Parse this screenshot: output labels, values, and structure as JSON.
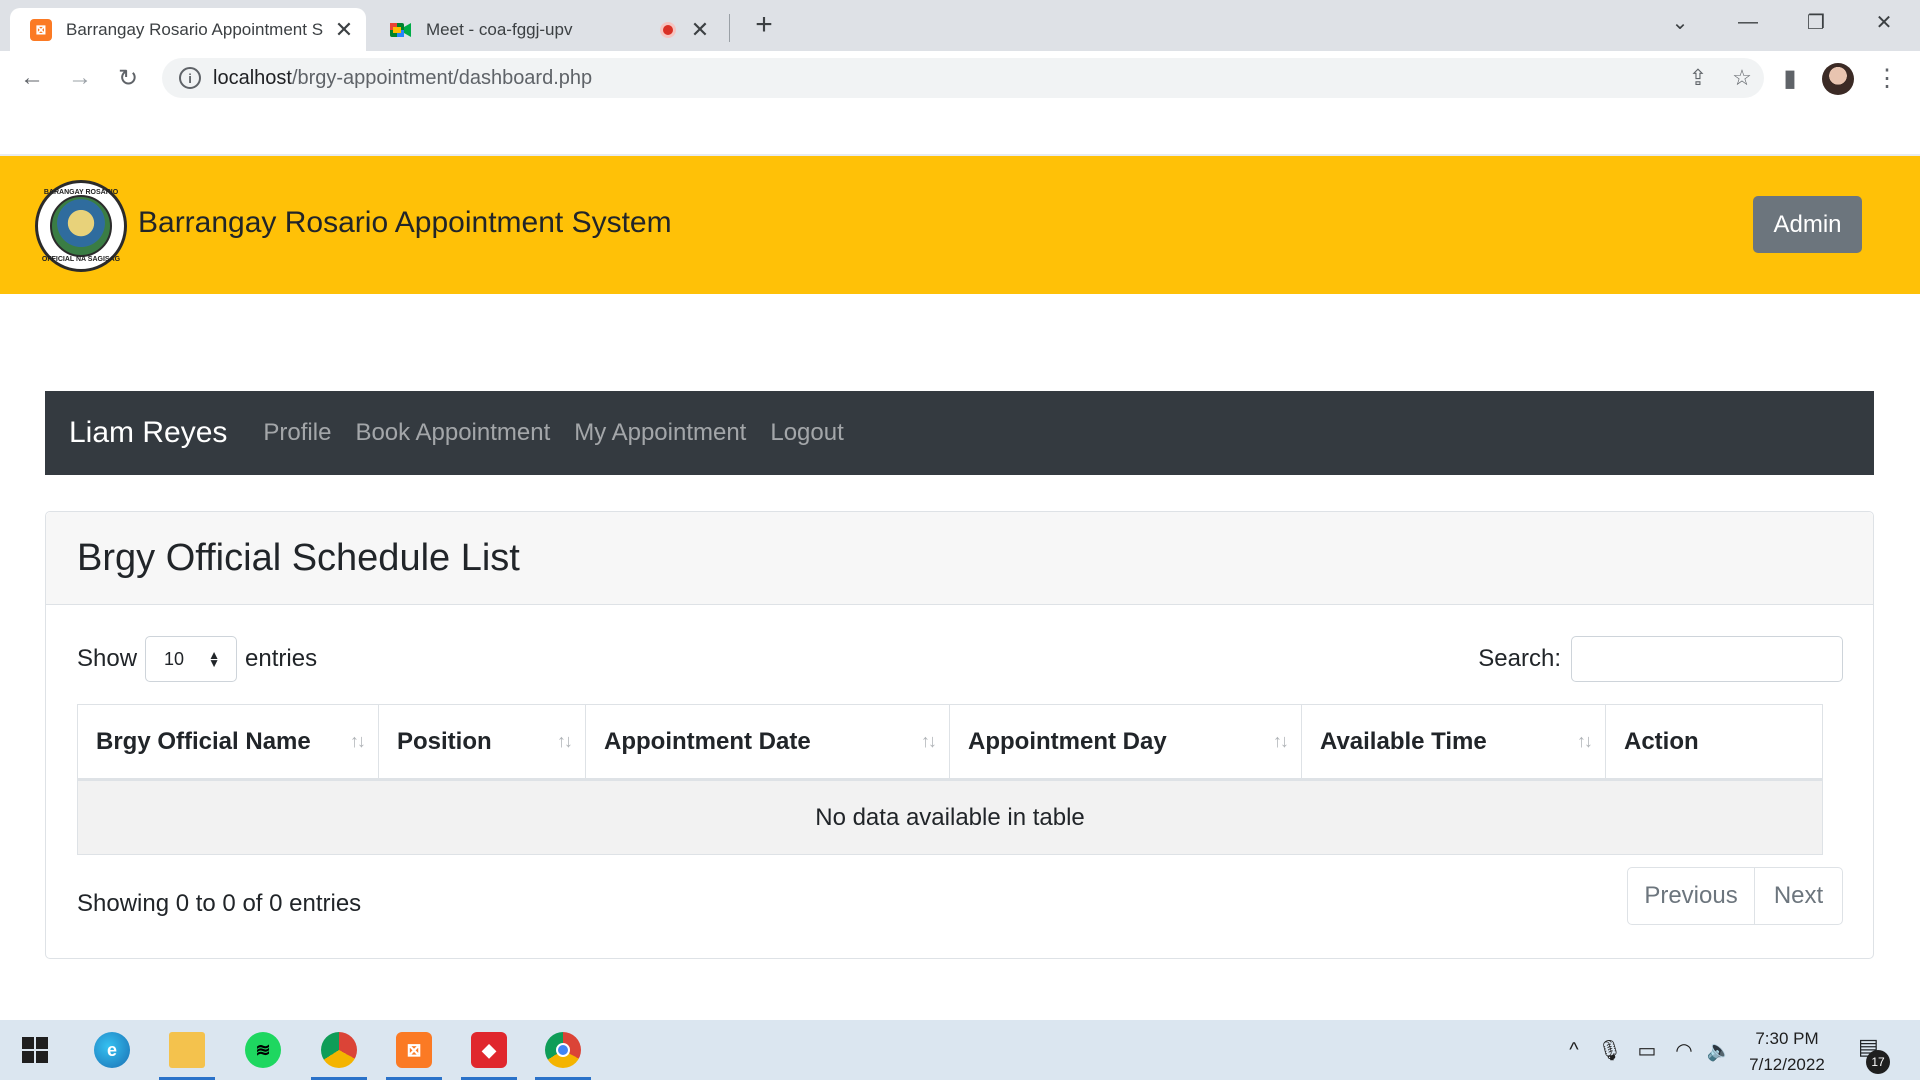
{
  "browser": {
    "tabs": [
      {
        "title": "Barrangay Rosario Appointment S",
        "active": true,
        "icon": "xampp-icon"
      },
      {
        "title": "Meet - coa-fggj-upv",
        "active": false,
        "icon": "google-meet-icon"
      }
    ],
    "url_host": "localhost",
    "url_path": "/brgy-appointment/dashboard.php"
  },
  "header": {
    "title": "Barrangay Rosario Appointment System",
    "admin_label": "Admin",
    "seal_text_top": "BARANGAY ROSARIO",
    "seal_text_bottom": "OFFICIAL NA SAGISAG",
    "accent": "#ffc107"
  },
  "navbar": {
    "brand": "Liam Reyes",
    "links": [
      "Profile",
      "Book Appointment",
      "My Appointment",
      "Logout"
    ],
    "background": "#343a40"
  },
  "card": {
    "title": "Brgy Official Schedule List",
    "show_label": "Show",
    "entries_label": "entries",
    "page_length": "10",
    "search_label": "Search:",
    "search_value": "",
    "columns": [
      "Brgy Official Name",
      "Position",
      "Appointment Date",
      "Appointment Day",
      "Available Time",
      "Action"
    ],
    "empty_message": "No data available in table",
    "info": "Showing 0 to 0 of 0 entries",
    "prev_label": "Previous",
    "next_label": "Next"
  },
  "taskbar": {
    "time": "7:30 PM",
    "date": "7/12/2022",
    "notification_count": "17",
    "apps": [
      "start-icon",
      "edge-icon",
      "file-explorer-icon",
      "spotify-icon",
      "chrome-profile-icon",
      "xampp-icon",
      "git-icon",
      "chrome-icon"
    ]
  }
}
